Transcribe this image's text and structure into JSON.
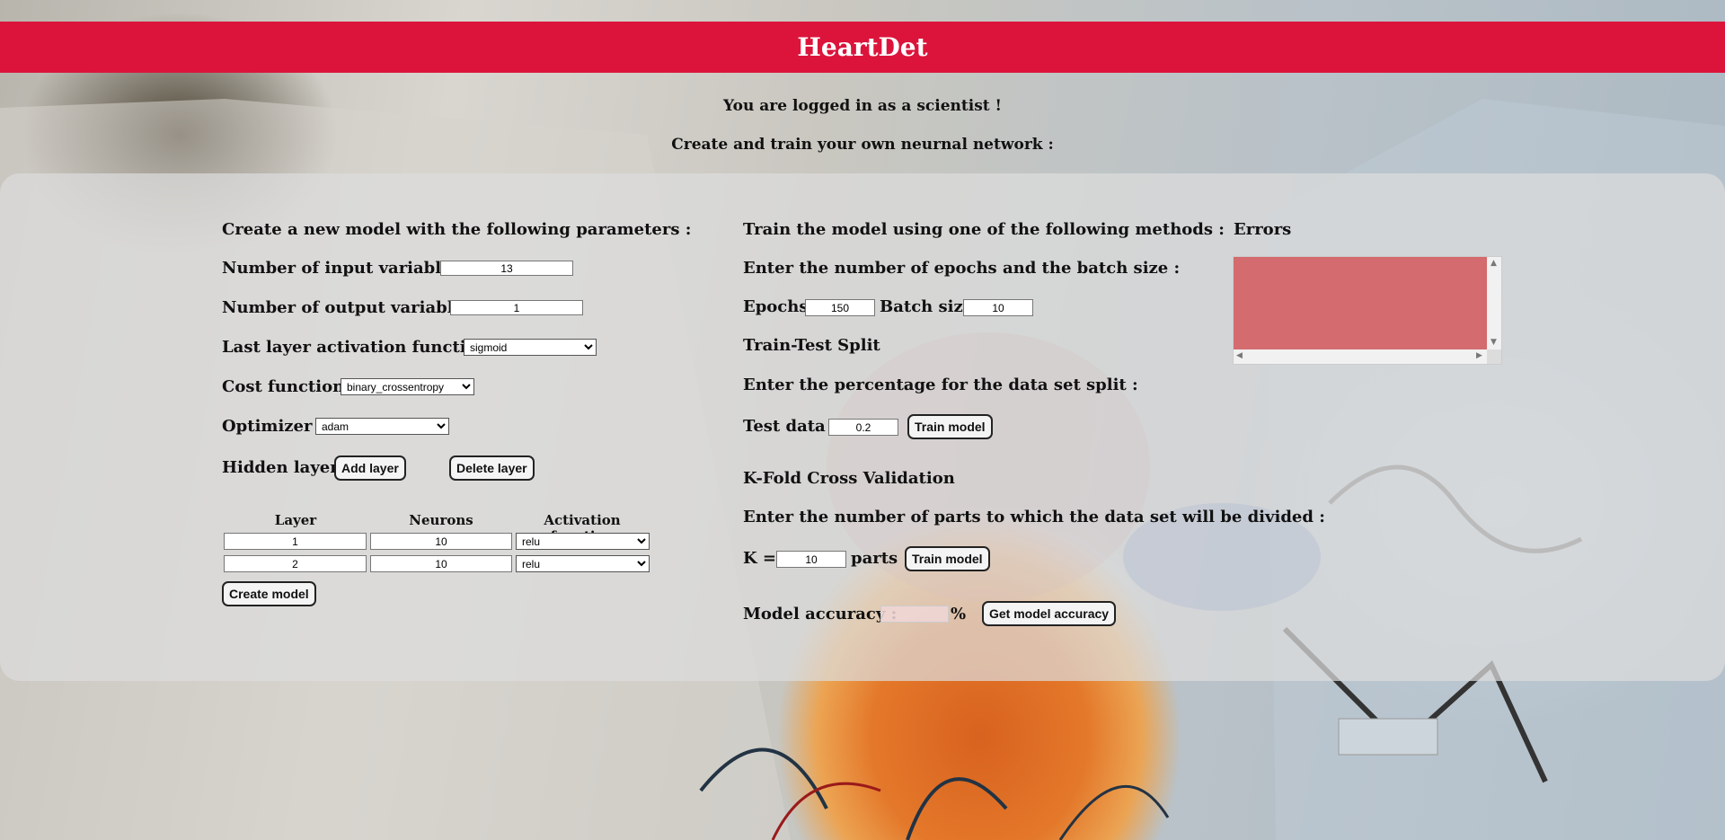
{
  "header": {
    "title": "HeartDet"
  },
  "intro": {
    "logged_in": "You are logged in as a scientist !",
    "create_train": "Create and train your own neurnal network :"
  },
  "create": {
    "heading": "Create a new model with the following parameters :",
    "input_vars_label": "Number of input variables :",
    "input_vars_value": "13",
    "output_vars_label": "Number of output variables :",
    "output_vars_value": "1",
    "last_activation_label": "Last layer activation function :",
    "last_activation_value": "sigmoid",
    "cost_label": "Cost function :",
    "cost_value": "binary_crossentropy",
    "optimizer_label": "Optimizer :",
    "optimizer_value": "adam",
    "hidden_layers_label": "Hidden layers",
    "add_layer_button": "Add layer",
    "delete_layer_button": "Delete layer",
    "table_headers": {
      "layer": "Layer",
      "neurons": "Neurons",
      "activation": "Activation function"
    },
    "rows": [
      {
        "layer": "1",
        "neurons": "10",
        "activation": "relu"
      },
      {
        "layer": "2",
        "neurons": "10",
        "activation": "relu"
      }
    ],
    "create_model_button": "Create model"
  },
  "train": {
    "heading": "Train the model using one of the following methods :",
    "epochs_batch_label": "Enter the number of epochs and the batch size :",
    "epochs_label": "Epochs:",
    "epochs_value": "150",
    "batch_label": "Batch size:",
    "batch_value": "10",
    "tts_heading": "Train-Test Split",
    "tts_prompt": "Enter the percentage for the data set split :",
    "test_data_label": "Test data :",
    "test_data_value": "0.2",
    "train_button_1": "Train model",
    "kfold_heading": "K-Fold Cross Validation",
    "kfold_prompt": "Enter the number of parts to which the data set will be divided :",
    "k_label": "K =",
    "k_value": "10",
    "parts_label": "parts",
    "train_button_2": "Train model",
    "accuracy_label": "Model accuracy :",
    "accuracy_value": "",
    "percent_sign": "%",
    "get_accuracy_button": "Get model accuracy"
  },
  "errors": {
    "heading": "Errors",
    "content": ""
  },
  "colors": {
    "header_bg": "#dc143c",
    "errors_bg": "#d46b6f"
  }
}
